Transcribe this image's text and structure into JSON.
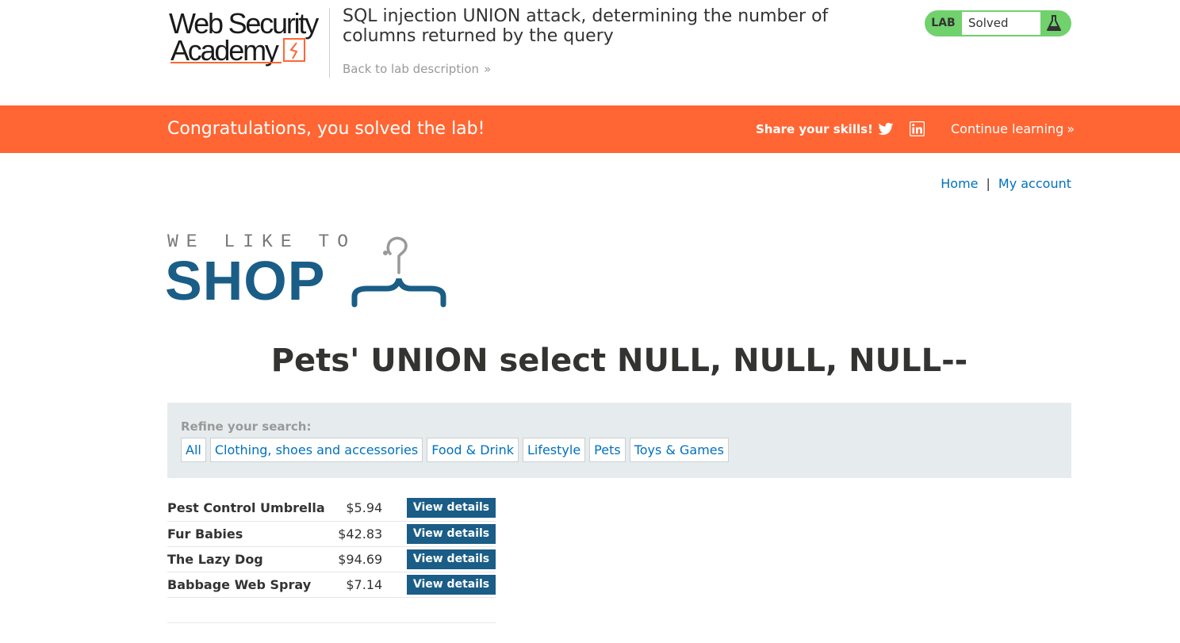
{
  "academy": {
    "logo_line1": "Web Security",
    "logo_line2": "Academy",
    "lab_title": "SQL injection UNION attack, determining the number of columns returned by the query",
    "back_link": "Back to lab description",
    "back_link_chevron": "»",
    "lab_tag": "LAB",
    "lab_state": "Solved",
    "flask_icon": "flask-icon"
  },
  "banner": {
    "congrats": "Congratulations, you solved the lab!",
    "share": "Share your skills!",
    "continue": "Continue learning",
    "continue_chevron": "»",
    "colors": {
      "background": "#ff6633"
    }
  },
  "nav": {
    "home": "Home",
    "separator": "|",
    "account": "My account"
  },
  "shop_logo": {
    "tagline": "WE LIKE TO",
    "word": "SHOP"
  },
  "page_title": "Pets' UNION select NULL, NULL, NULL--",
  "refine": {
    "label": "Refine your search:",
    "filters": [
      "All",
      "Clothing, shoes and accessories",
      "Food & Drink",
      "Lifestyle",
      "Pets",
      "Toys & Games"
    ]
  },
  "products": [
    {
      "name": "Pest Control Umbrella",
      "price": "$5.94",
      "action": "View details"
    },
    {
      "name": "Fur Babies",
      "price": "$42.83",
      "action": "View details"
    },
    {
      "name": "The Lazy Dog",
      "price": "$94.69",
      "action": "View details"
    },
    {
      "name": "Babbage Web Spray",
      "price": "$7.14",
      "action": "View details"
    }
  ],
  "colors": {
    "accent_orange": "#ff6633",
    "link_blue": "#0071bc",
    "shop_blue": "#1a5d87",
    "solved_green": "#70d16d"
  }
}
